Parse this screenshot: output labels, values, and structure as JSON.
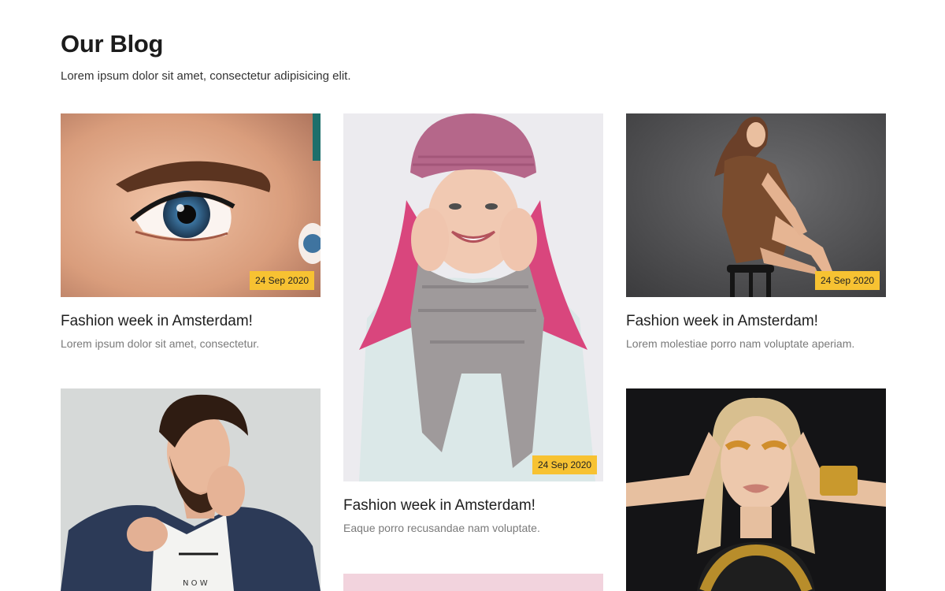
{
  "section": {
    "title": "Our Blog",
    "subtitle": "Lorem ipsum dolor sit amet, consectetur adipisicing elit."
  },
  "posts": [
    {
      "image": "close-up-eye-photo",
      "date": "24 Sep 2020",
      "title": "Fashion week in Amsterdam!",
      "excerpt": "Lorem ipsum dolor sit amet, consectetur."
    },
    {
      "image": "woman-pink-hair-beanie-scarf-photo",
      "date": "24 Sep 2020",
      "title": "Fashion week in Amsterdam!",
      "excerpt": "Eaque porro recusandae nam voluptate."
    },
    {
      "image": "woman-sitting-on-stool-photo",
      "date": "24 Sep 2020",
      "title": "Fashion week in Amsterdam!",
      "excerpt": "Lorem molestiae porro nam voluptate aperiam."
    },
    {
      "image": "bearded-man-denim-jacket-photo"
    },
    {
      "image": "woman-gold-makeup-photo"
    },
    {
      "image": "pink-background-photo"
    }
  ],
  "colors": {
    "badge": "#f7c232",
    "title": "#1e1e1e",
    "excerpt": "#7a7a7a"
  }
}
